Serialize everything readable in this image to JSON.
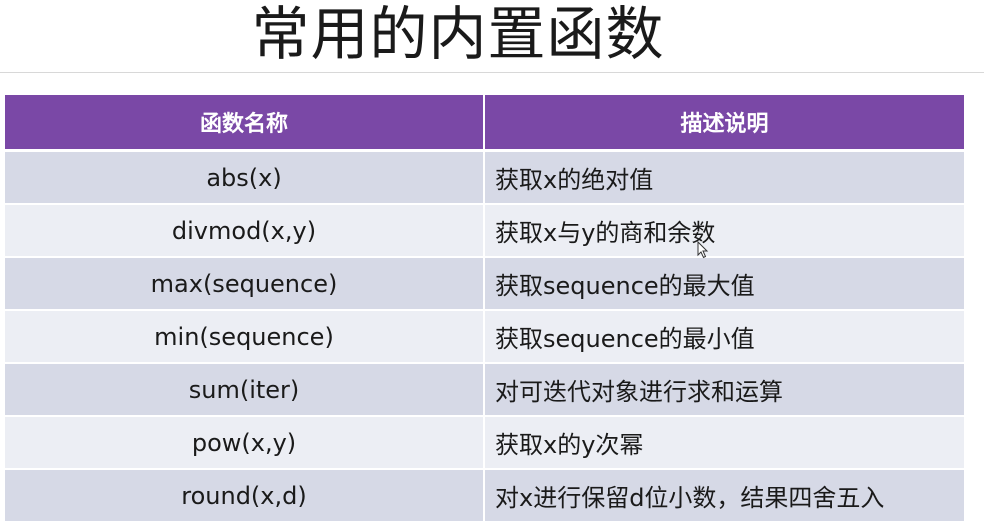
{
  "slide": {
    "title": "常用的内置函数"
  },
  "table": {
    "headers": [
      "函数名称",
      "描述说明"
    ],
    "rows": [
      {
        "function": "abs(x)",
        "description": "获取x的绝对值"
      },
      {
        "function": "divmod(x,y)",
        "description": "获取x与y的商和余数"
      },
      {
        "function": "max(sequence)",
        "description": "获取sequence的最大值"
      },
      {
        "function": "min(sequence)",
        "description": "获取sequence的最小值"
      },
      {
        "function": "sum(iter)",
        "description": "对可迭代对象进行求和运算"
      },
      {
        "function": "pow(x,y)",
        "description": "获取x的y次幂"
      },
      {
        "function": "round(x,d)",
        "description": "对x进行保留d位小数，结果四舍五入"
      }
    ]
  },
  "colors": {
    "header_bg": "#7a48a6",
    "row_dark": "#d6d9e6",
    "row_light": "#eceef4"
  }
}
